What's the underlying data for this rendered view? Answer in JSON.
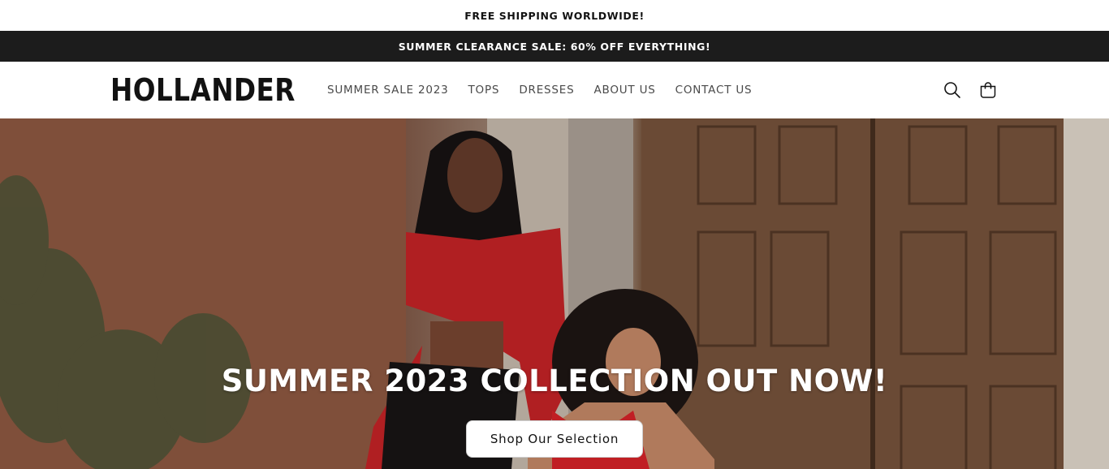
{
  "announcements": {
    "shipping": "FREE SHIPPING WORLDWIDE!",
    "sale": "SUMMER CLEARANCE SALE: 60% OFF EVERYTHING!"
  },
  "header": {
    "logo": "HOLLANDER",
    "nav": [
      {
        "label": "SUMMER SALE 2023"
      },
      {
        "label": "TOPS"
      },
      {
        "label": "DRESSES"
      },
      {
        "label": "ABOUT US"
      },
      {
        "label": "CONTACT US"
      }
    ],
    "icons": [
      "search-icon",
      "cart-icon"
    ]
  },
  "hero": {
    "title": "SUMMER 2023 COLLECTION OUT NOW!",
    "cta_label": "Shop Our Selection"
  },
  "colors": {
    "announcement_bar": "#1c1c1c",
    "text": "#121212",
    "nav_text": "#4a4a4a"
  }
}
